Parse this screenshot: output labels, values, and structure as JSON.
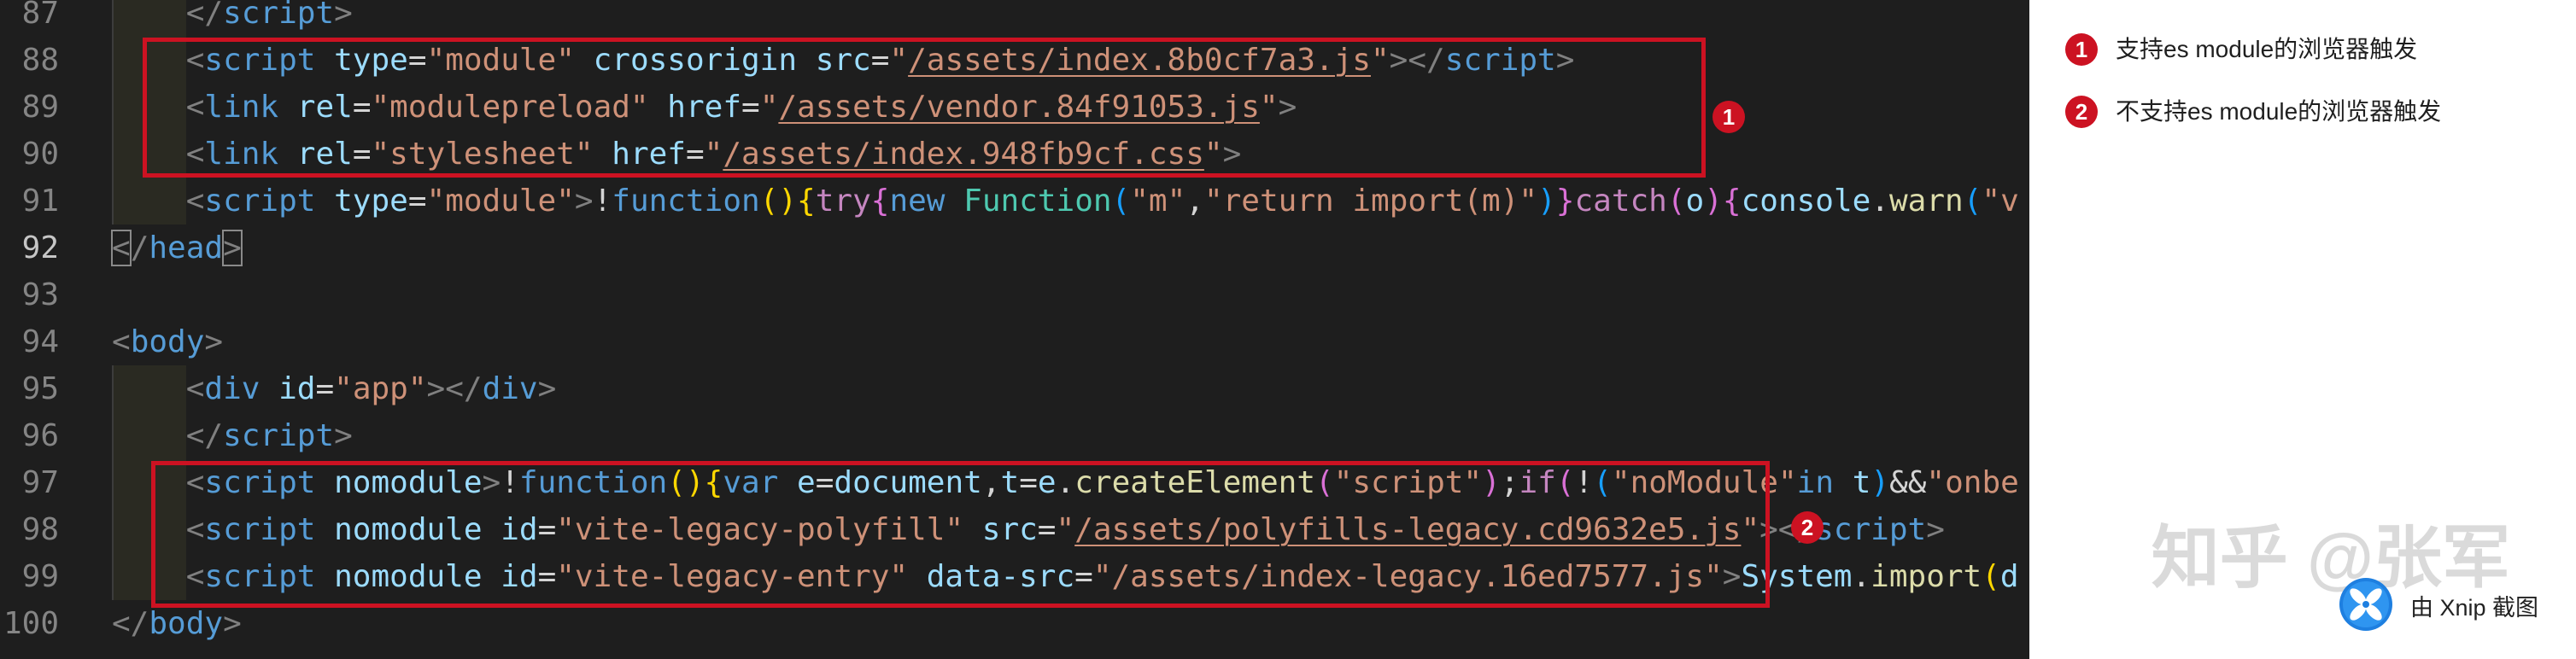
{
  "colors": {
    "annotation_red": "#cc1222",
    "editor_background": "#1e1e1e",
    "panel_background": "#ffffff"
  },
  "editor": {
    "active_line": "92",
    "lines": [
      {
        "number": "87",
        "tokens": [
          {
            "text": "    ",
            "color": "#d4d4d4"
          },
          {
            "text": "</",
            "color": "#808080"
          },
          {
            "text": "script",
            "color": "#569cd6"
          },
          {
            "text": ">",
            "color": "#808080"
          }
        ]
      },
      {
        "number": "88",
        "tokens": [
          {
            "text": "    ",
            "color": "#d4d4d4"
          },
          {
            "text": "<",
            "color": "#808080"
          },
          {
            "text": "script",
            "color": "#569cd6"
          },
          {
            "text": " ",
            "color": "#d4d4d4"
          },
          {
            "text": "type",
            "color": "#9cdcfe"
          },
          {
            "text": "=",
            "color": "#d4d4d4"
          },
          {
            "text": "\"module\"",
            "color": "#ce9178"
          },
          {
            "text": " ",
            "color": "#d4d4d4"
          },
          {
            "text": "crossorigin",
            "color": "#9cdcfe"
          },
          {
            "text": " ",
            "color": "#d4d4d4"
          },
          {
            "text": "src",
            "color": "#9cdcfe"
          },
          {
            "text": "=",
            "color": "#d4d4d4"
          },
          {
            "text": "\"",
            "color": "#ce9178"
          },
          {
            "text": "/assets/index.8b0cf7a3.js",
            "color": "#ce9178",
            "underline": true
          },
          {
            "text": "\"",
            "color": "#ce9178"
          },
          {
            "text": "></",
            "color": "#808080"
          },
          {
            "text": "script",
            "color": "#569cd6"
          },
          {
            "text": ">",
            "color": "#808080"
          }
        ]
      },
      {
        "number": "89",
        "tokens": [
          {
            "text": "    ",
            "color": "#d4d4d4"
          },
          {
            "text": "<",
            "color": "#808080"
          },
          {
            "text": "link",
            "color": "#569cd6"
          },
          {
            "text": " ",
            "color": "#d4d4d4"
          },
          {
            "text": "rel",
            "color": "#9cdcfe"
          },
          {
            "text": "=",
            "color": "#d4d4d4"
          },
          {
            "text": "\"modulepreload\"",
            "color": "#ce9178"
          },
          {
            "text": " ",
            "color": "#d4d4d4"
          },
          {
            "text": "href",
            "color": "#9cdcfe"
          },
          {
            "text": "=",
            "color": "#d4d4d4"
          },
          {
            "text": "\"",
            "color": "#ce9178"
          },
          {
            "text": "/assets/vendor.84f91053.js",
            "color": "#ce9178",
            "underline": true
          },
          {
            "text": "\"",
            "color": "#ce9178"
          },
          {
            "text": ">",
            "color": "#808080"
          }
        ]
      },
      {
        "number": "90",
        "tokens": [
          {
            "text": "    ",
            "color": "#d4d4d4"
          },
          {
            "text": "<",
            "color": "#808080"
          },
          {
            "text": "link",
            "color": "#569cd6"
          },
          {
            "text": " ",
            "color": "#d4d4d4"
          },
          {
            "text": "rel",
            "color": "#9cdcfe"
          },
          {
            "text": "=",
            "color": "#d4d4d4"
          },
          {
            "text": "\"stylesheet\"",
            "color": "#ce9178"
          },
          {
            "text": " ",
            "color": "#d4d4d4"
          },
          {
            "text": "href",
            "color": "#9cdcfe"
          },
          {
            "text": "=",
            "color": "#d4d4d4"
          },
          {
            "text": "\"",
            "color": "#ce9178"
          },
          {
            "text": "/assets/index.948fb9cf.css",
            "color": "#ce9178",
            "underline": true
          },
          {
            "text": "\"",
            "color": "#ce9178"
          },
          {
            "text": ">",
            "color": "#808080"
          }
        ]
      },
      {
        "number": "91",
        "tokens": [
          {
            "text": "    ",
            "color": "#d4d4d4"
          },
          {
            "text": "<",
            "color": "#808080"
          },
          {
            "text": "script",
            "color": "#569cd6"
          },
          {
            "text": " ",
            "color": "#d4d4d4"
          },
          {
            "text": "type",
            "color": "#9cdcfe"
          },
          {
            "text": "=",
            "color": "#d4d4d4"
          },
          {
            "text": "\"module\"",
            "color": "#ce9178"
          },
          {
            "text": ">",
            "color": "#808080"
          },
          {
            "text": "!",
            "color": "#d4d4d4"
          },
          {
            "text": "function",
            "color": "#569cd6"
          },
          {
            "text": "()",
            "color": "#ffd700"
          },
          {
            "text": "{",
            "color": "#ffd700"
          },
          {
            "text": "try",
            "color": "#c586c0"
          },
          {
            "text": "{",
            "color": "#da70d6"
          },
          {
            "text": "new",
            "color": "#569cd6"
          },
          {
            "text": " ",
            "color": "#d4d4d4"
          },
          {
            "text": "Function",
            "color": "#4ec9b0"
          },
          {
            "text": "(",
            "color": "#179fff"
          },
          {
            "text": "\"m\"",
            "color": "#ce9178"
          },
          {
            "text": ",",
            "color": "#d4d4d4"
          },
          {
            "text": "\"return import(m)\"",
            "color": "#ce9178"
          },
          {
            "text": ")",
            "color": "#179fff"
          },
          {
            "text": "}",
            "color": "#da70d6"
          },
          {
            "text": "catch",
            "color": "#c586c0"
          },
          {
            "text": "(",
            "color": "#da70d6"
          },
          {
            "text": "o",
            "color": "#9cdcfe"
          },
          {
            "text": ")",
            "color": "#da70d6"
          },
          {
            "text": "{",
            "color": "#da70d6"
          },
          {
            "text": "console",
            "color": "#9cdcfe"
          },
          {
            "text": ".",
            "color": "#d4d4d4"
          },
          {
            "text": "warn",
            "color": "#dcdcaa"
          },
          {
            "text": "(",
            "color": "#179fff"
          },
          {
            "text": "\"v",
            "color": "#ce9178"
          }
        ]
      },
      {
        "number": "92",
        "tokens": [
          {
            "text": "<",
            "color": "#808080",
            "bracket_match": true
          },
          {
            "text": "/",
            "color": "#808080"
          },
          {
            "text": "head",
            "color": "#569cd6"
          },
          {
            "text": ">",
            "color": "#808080",
            "bracket_match": true
          }
        ]
      },
      {
        "number": "93",
        "tokens": []
      },
      {
        "number": "94",
        "tokens": [
          {
            "text": "<",
            "color": "#808080"
          },
          {
            "text": "body",
            "color": "#569cd6"
          },
          {
            "text": ">",
            "color": "#808080"
          }
        ]
      },
      {
        "number": "95",
        "tokens": [
          {
            "text": "    ",
            "color": "#d4d4d4"
          },
          {
            "text": "<",
            "color": "#808080"
          },
          {
            "text": "div",
            "color": "#569cd6"
          },
          {
            "text": " ",
            "color": "#d4d4d4"
          },
          {
            "text": "id",
            "color": "#9cdcfe"
          },
          {
            "text": "=",
            "color": "#d4d4d4"
          },
          {
            "text": "\"app\"",
            "color": "#ce9178"
          },
          {
            "text": "></",
            "color": "#808080"
          },
          {
            "text": "div",
            "color": "#569cd6"
          },
          {
            "text": ">",
            "color": "#808080"
          }
        ]
      },
      {
        "number": "96",
        "tokens": [
          {
            "text": "    ",
            "color": "#d4d4d4"
          },
          {
            "text": "</",
            "color": "#808080"
          },
          {
            "text": "script",
            "color": "#569cd6"
          },
          {
            "text": ">",
            "color": "#808080"
          }
        ]
      },
      {
        "number": "97",
        "tokens": [
          {
            "text": "    ",
            "color": "#d4d4d4"
          },
          {
            "text": "<",
            "color": "#808080"
          },
          {
            "text": "script",
            "color": "#569cd6"
          },
          {
            "text": " ",
            "color": "#d4d4d4"
          },
          {
            "text": "nomodule",
            "color": "#9cdcfe"
          },
          {
            "text": ">",
            "color": "#808080"
          },
          {
            "text": "!",
            "color": "#d4d4d4"
          },
          {
            "text": "function",
            "color": "#569cd6"
          },
          {
            "text": "()",
            "color": "#ffd700"
          },
          {
            "text": "{",
            "color": "#ffd700"
          },
          {
            "text": "var",
            "color": "#569cd6"
          },
          {
            "text": " ",
            "color": "#d4d4d4"
          },
          {
            "text": "e",
            "color": "#9cdcfe"
          },
          {
            "text": "=",
            "color": "#d4d4d4"
          },
          {
            "text": "document",
            "color": "#9cdcfe"
          },
          {
            "text": ",",
            "color": "#d4d4d4"
          },
          {
            "text": "t",
            "color": "#9cdcfe"
          },
          {
            "text": "=",
            "color": "#d4d4d4"
          },
          {
            "text": "e",
            "color": "#9cdcfe"
          },
          {
            "text": ".",
            "color": "#d4d4d4"
          },
          {
            "text": "createElement",
            "color": "#dcdcaa"
          },
          {
            "text": "(",
            "color": "#da70d6"
          },
          {
            "text": "\"script\"",
            "color": "#ce9178"
          },
          {
            "text": ")",
            "color": "#da70d6"
          },
          {
            "text": ";",
            "color": "#d4d4d4"
          },
          {
            "text": "if",
            "color": "#c586c0"
          },
          {
            "text": "(",
            "color": "#da70d6"
          },
          {
            "text": "!",
            "color": "#d4d4d4"
          },
          {
            "text": "(",
            "color": "#179fff"
          },
          {
            "text": "\"noModule\"",
            "color": "#ce9178"
          },
          {
            "text": "in",
            "color": "#569cd6"
          },
          {
            "text": " ",
            "color": "#d4d4d4"
          },
          {
            "text": "t",
            "color": "#9cdcfe"
          },
          {
            "text": ")",
            "color": "#179fff"
          },
          {
            "text": "&&",
            "color": "#d4d4d4"
          },
          {
            "text": "\"onbe",
            "color": "#ce9178"
          }
        ]
      },
      {
        "number": "98",
        "tokens": [
          {
            "text": "    ",
            "color": "#d4d4d4"
          },
          {
            "text": "<",
            "color": "#808080"
          },
          {
            "text": "script",
            "color": "#569cd6"
          },
          {
            "text": " ",
            "color": "#d4d4d4"
          },
          {
            "text": "nomodule",
            "color": "#9cdcfe"
          },
          {
            "text": " ",
            "color": "#d4d4d4"
          },
          {
            "text": "id",
            "color": "#9cdcfe"
          },
          {
            "text": "=",
            "color": "#d4d4d4"
          },
          {
            "text": "\"vite-legacy-polyfill\"",
            "color": "#ce9178"
          },
          {
            "text": " ",
            "color": "#d4d4d4"
          },
          {
            "text": "src",
            "color": "#9cdcfe"
          },
          {
            "text": "=",
            "color": "#d4d4d4"
          },
          {
            "text": "\"",
            "color": "#ce9178"
          },
          {
            "text": "/assets/polyfills-legacy.cd9632e5.js",
            "color": "#ce9178",
            "underline": true
          },
          {
            "text": "\"",
            "color": "#ce9178"
          },
          {
            "text": "></",
            "color": "#808080"
          },
          {
            "text": "script",
            "color": "#569cd6"
          },
          {
            "text": ">",
            "color": "#808080"
          }
        ]
      },
      {
        "number": "99",
        "tokens": [
          {
            "text": "    ",
            "color": "#d4d4d4"
          },
          {
            "text": "<",
            "color": "#808080"
          },
          {
            "text": "script",
            "color": "#569cd6"
          },
          {
            "text": " ",
            "color": "#d4d4d4"
          },
          {
            "text": "nomodule",
            "color": "#9cdcfe"
          },
          {
            "text": " ",
            "color": "#d4d4d4"
          },
          {
            "text": "id",
            "color": "#9cdcfe"
          },
          {
            "text": "=",
            "color": "#d4d4d4"
          },
          {
            "text": "\"vite-legacy-entry\"",
            "color": "#ce9178"
          },
          {
            "text": " ",
            "color": "#d4d4d4"
          },
          {
            "text": "data-src",
            "color": "#9cdcfe"
          },
          {
            "text": "=",
            "color": "#d4d4d4"
          },
          {
            "text": "\"/assets/index-legacy.16ed7577.js\"",
            "color": "#ce9178"
          },
          {
            "text": ">",
            "color": "#808080"
          },
          {
            "text": "System",
            "color": "#9cdcfe"
          },
          {
            "text": ".",
            "color": "#d4d4d4"
          },
          {
            "text": "import",
            "color": "#dcdcaa"
          },
          {
            "text": "(",
            "color": "#ffd700"
          },
          {
            "text": "d",
            "color": "#9cdcfe"
          }
        ]
      },
      {
        "number": "100",
        "tokens": [
          {
            "text": "</",
            "color": "#808080"
          },
          {
            "text": "body",
            "color": "#569cd6"
          },
          {
            "text": ">",
            "color": "#808080"
          }
        ]
      }
    ]
  },
  "annotations": [
    {
      "label": "1"
    },
    {
      "label": "2"
    }
  ],
  "legend": [
    {
      "badge": "1",
      "text": "支持es module的浏览器触发"
    },
    {
      "badge": "2",
      "text": "不支持es module的浏览器触发"
    }
  ],
  "watermark": "知乎 @张军",
  "capture_credit": "由 Xnip 截图",
  "icons": {
    "capture_logo": "xnip-logo-icon"
  }
}
